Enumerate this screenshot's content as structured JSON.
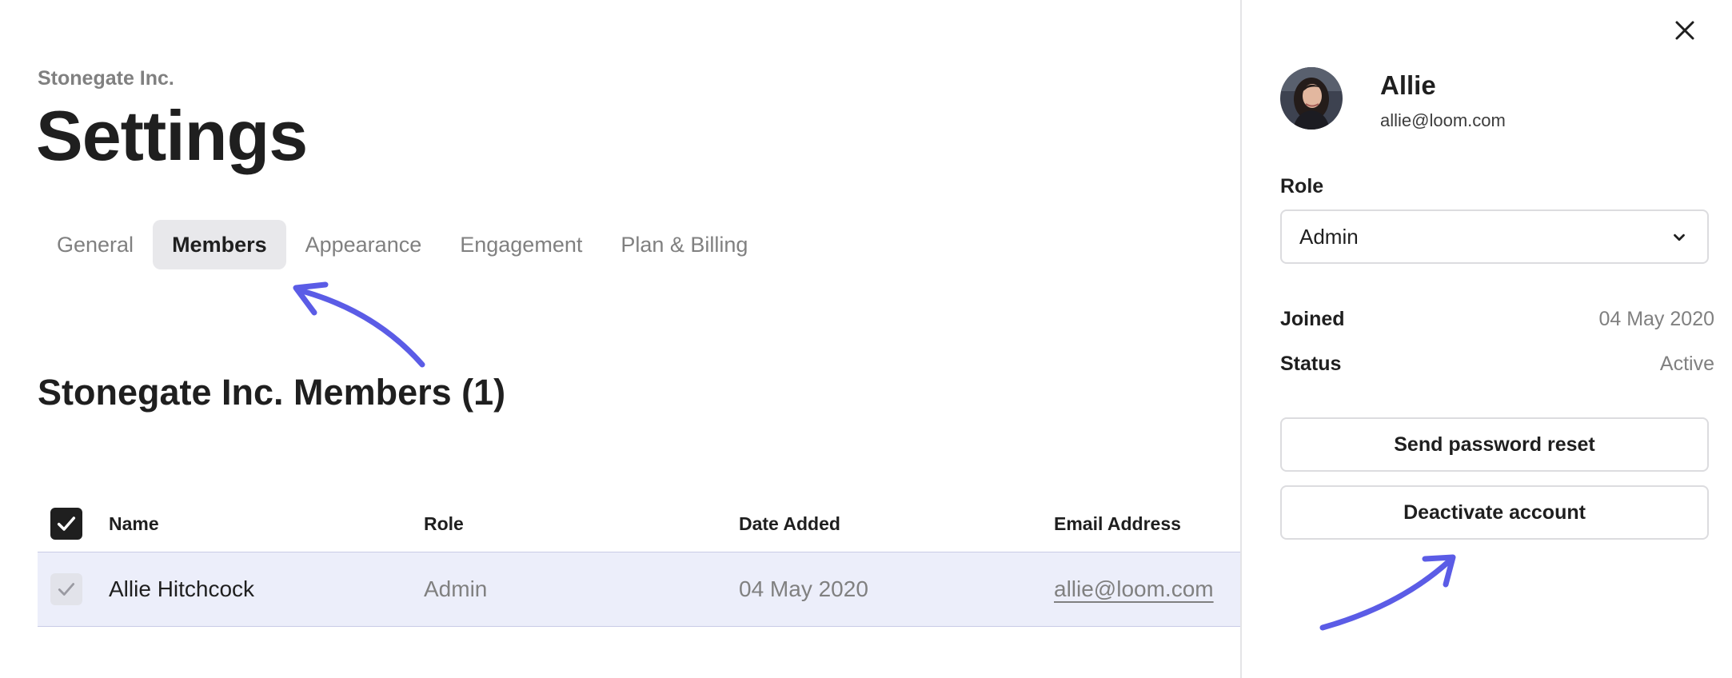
{
  "header": {
    "org_name": "Stonegate Inc.",
    "title": "Settings"
  },
  "tabs": [
    {
      "label": "General",
      "active": false
    },
    {
      "label": "Members",
      "active": true
    },
    {
      "label": "Appearance",
      "active": false
    },
    {
      "label": "Engagement",
      "active": false
    },
    {
      "label": "Plan & Billing",
      "active": false
    }
  ],
  "members": {
    "section_title": "Stonegate Inc. Members (1)",
    "columns": [
      "Name",
      "Role",
      "Date Added",
      "Email Address"
    ],
    "rows": [
      {
        "name": "Allie Hitchcock",
        "role": "Admin",
        "date_added": "04 May 2020",
        "email": "allie@loom.com"
      }
    ]
  },
  "panel": {
    "user_name": "Allie",
    "user_email": "allie@loom.com",
    "role_label": "Role",
    "role_value": "Admin",
    "joined_label": "Joined",
    "joined_value": "04 May 2020",
    "status_label": "Status",
    "status_value": "Active",
    "send_reset_label": "Send password reset",
    "deactivate_label": "Deactivate account"
  },
  "icons": {
    "close": "close-icon",
    "chevron": "chevron-down-icon",
    "check": "checkmark-icon",
    "annotation": "annotation-arrow-icon"
  },
  "colors": {
    "text": "#1f1f1f",
    "muted": "#808080",
    "active_tab_bg": "#e8e8eb",
    "selected_row_bg": "#eceefa",
    "annotation_arrow": "#5b5ce6"
  }
}
